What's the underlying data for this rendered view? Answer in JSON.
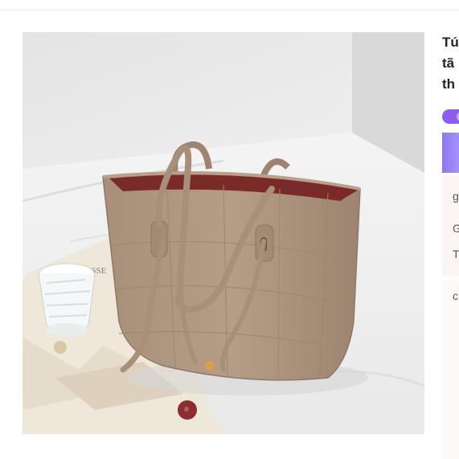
{
  "product": {
    "image_alt": "Tan leather tote bag on white bed sheet",
    "title_lines": [
      "Tú",
      "tã",
      "th"
    ]
  },
  "side_panel": {
    "badge_color": "#8a5cf0",
    "banner_colors": [
      "#8d78f2",
      "#b8a6ff"
    ],
    "price_lines": [
      "g",
      "G",
      "T"
    ],
    "shipping_line": "c"
  },
  "decor": {
    "vase_label": "TISSE"
  }
}
